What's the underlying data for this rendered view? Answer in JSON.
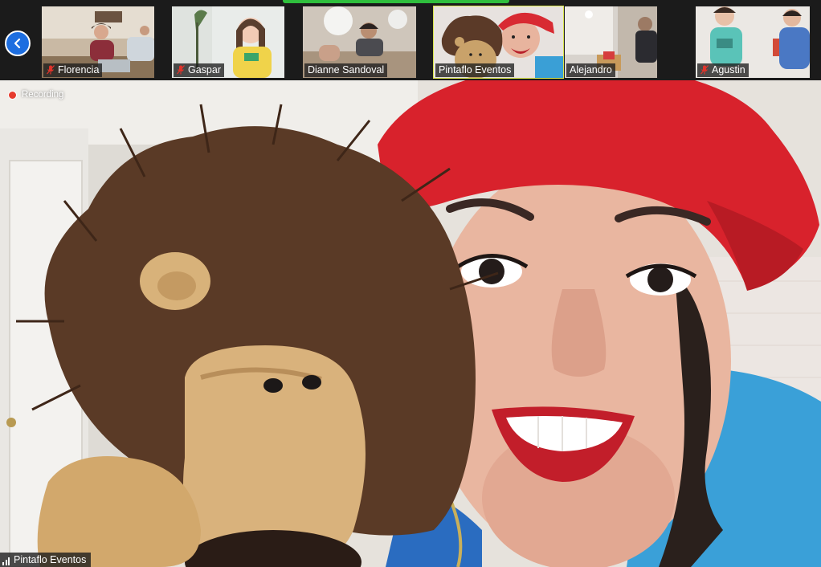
{
  "gallery": {
    "participants": [
      {
        "name": "Florencia",
        "muted": true
      },
      {
        "name": "Gaspar",
        "muted": true
      },
      {
        "name": "Dianne Sandoval",
        "muted": false
      },
      {
        "name": "Pintaflo Eventos",
        "muted": false
      },
      {
        "name": "Alejandro",
        "muted": false
      },
      {
        "name": "Agustin",
        "muted": true
      }
    ]
  },
  "meeting": {
    "recording_label": "Recording",
    "active_speaker_name": "Pintaflo Eventos"
  },
  "colors": {
    "nav_button": "#1d6ee0",
    "active_speaker_indicator": "#2fbf3d",
    "muted_icon": "#e0342b",
    "recording_dot": "#e63b2e"
  }
}
